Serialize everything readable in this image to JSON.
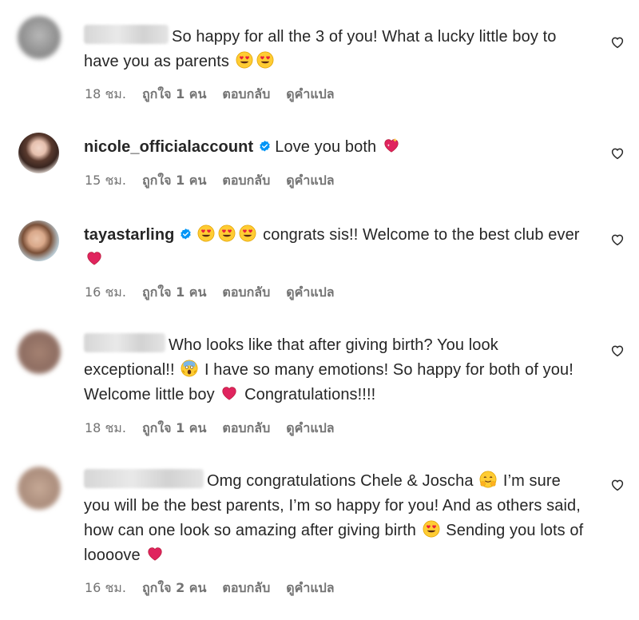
{
  "comments": [
    {
      "username_hidden": true,
      "text_a": "So happy for all the 3 of you! What a lucky little boy to have you as parents",
      "time": "18 ชม.",
      "likes": "ถูกใจ 1 คน",
      "reply": "ตอบกลับ",
      "translate": "ดูคำแปล"
    },
    {
      "username": "nicole_officialaccount",
      "verified": true,
      "text_a": "Love you both",
      "time": "15 ชม.",
      "likes": "ถูกใจ 1 คน",
      "reply": "ตอบกลับ",
      "translate": "ดูคำแปล"
    },
    {
      "username": "tayastarling",
      "verified": true,
      "text_a": "congrats sis!! Welcome to the best club ever",
      "time": "16 ชม.",
      "likes": "ถูกใจ 1 คน",
      "reply": "ตอบกลับ",
      "translate": "ดูคำแปล"
    },
    {
      "username_hidden": true,
      "text_a": "Who looks like that after giving birth? You look exceptional!!",
      "text_b": "I have so many emotions! So happy for both of you! Welcome little boy",
      "text_c": "Congratulations!!!!",
      "time": "18 ชม.",
      "likes": "ถูกใจ 1 คน",
      "reply": "ตอบกลับ",
      "translate": "ดูคำแปล"
    },
    {
      "username_hidden": true,
      "text_a": "Omg congratulations Chele & Joscha",
      "text_b": "I’m sure you will be the best parents, I’m so happy for you! And as others said, how can one look so amazing after giving birth",
      "text_c": "Sending you lots of loooove",
      "time": "16 ชม.",
      "likes": "ถูกใจ 2 คน",
      "reply": "ตอบกลับ",
      "translate": "ดูคำแปล"
    }
  ],
  "colors": {
    "meta_gray": "#737373",
    "verified_blue": "#0095f6",
    "heart_red": "#e0245e"
  },
  "icons": [
    "heart-outline-icon",
    "verified-badge-icon",
    "heart-eyes-emoji",
    "red-heart-emoji",
    "screaming-face-emoji",
    "sparkling-heart-emoji",
    "hugging-face-emoji"
  ]
}
